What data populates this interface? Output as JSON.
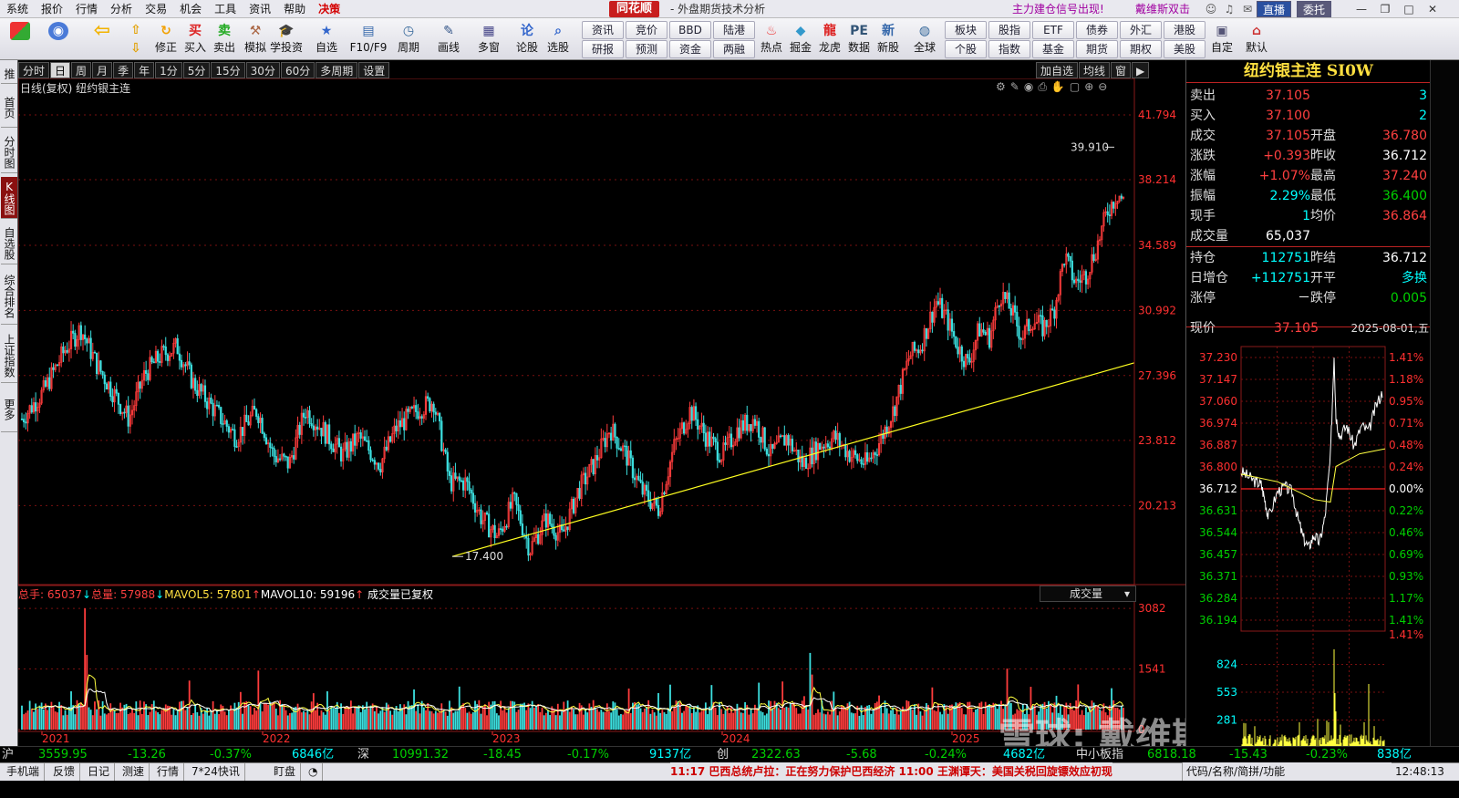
{
  "menu": [
    "系统",
    "报价",
    "行情",
    "分析",
    "交易",
    "机会",
    "工具",
    "资讯",
    "帮助",
    "决策"
  ],
  "brand": "同花顺",
  "brand_sub": "- 外盘期货技术分析",
  "menu_right": {
    "signal": "主力建仓信号出现!",
    "user": "戴维斯双击",
    "live": "直播",
    "entrust": "委托"
  },
  "toolbar": {
    "big": [
      {
        "label": "修正",
        "icon": "refresh-icon"
      },
      {
        "label": "买入",
        "icon": "buy-icon"
      },
      {
        "label": "卖出",
        "icon": "sell-icon"
      },
      {
        "label": "模拟",
        "icon": "hammer-icon"
      },
      {
        "label": "学投资",
        "icon": "graduation-icon"
      },
      {
        "label": "自选",
        "icon": "star-icon"
      },
      {
        "label": "F10/F9",
        "icon": "f10-icon"
      },
      {
        "label": "周期",
        "icon": "clock-icon"
      },
      {
        "label": "画线",
        "icon": "pen-icon"
      },
      {
        "label": "多窗",
        "icon": "windows-icon"
      },
      {
        "label": "论股",
        "icon": "chat-icon"
      },
      {
        "label": "选股",
        "icon": "search-icon"
      }
    ],
    "grid1": [
      "资讯",
      "竞价",
      "BBD",
      "陆港"
    ],
    "grid1b": [
      "研报",
      "预测",
      "资金",
      "两融"
    ],
    "big2": [
      {
        "label": "热点",
        "icon": "fire-icon"
      },
      {
        "label": "掘金",
        "icon": "gold-icon"
      },
      {
        "label": "龙虎",
        "icon": "dragon-icon"
      },
      {
        "label": "数据",
        "icon": "pe-icon"
      },
      {
        "label": "新股",
        "icon": "ipo-icon"
      },
      {
        "label": "全球",
        "icon": "globe-icon"
      }
    ],
    "grid2": [
      "板块",
      "股指",
      "ETF",
      "债券",
      "外汇",
      "港股"
    ],
    "grid2b": [
      "个股",
      "指数",
      "基金",
      "期货",
      "期权",
      "美股"
    ],
    "big3": [
      {
        "label": "自定",
        "icon": "custom-icon"
      },
      {
        "label": "默认",
        "icon": "home-icon"
      }
    ]
  },
  "left_tabs": [
    {
      "label": "推荐"
    },
    {
      "label": "首页"
    },
    {
      "label": "分时图"
    },
    {
      "label": "K线图",
      "active": true
    },
    {
      "label": "自选股"
    },
    {
      "label": "综合排名"
    },
    {
      "label": "上证指数"
    },
    {
      "label": "更多"
    }
  ],
  "period_tabs": [
    {
      "label": "分时"
    },
    {
      "label": "日",
      "active": true
    },
    {
      "label": "周"
    },
    {
      "label": "月"
    },
    {
      "label": "季"
    },
    {
      "label": "年"
    },
    {
      "label": "1分"
    },
    {
      "label": "5分"
    },
    {
      "label": "15分"
    },
    {
      "label": "30分"
    },
    {
      "label": "60分"
    },
    {
      "label": "多周期"
    },
    {
      "label": "设置"
    }
  ],
  "period_tabs_right": [
    "加自选",
    "均线",
    "窗",
    "▶"
  ],
  "chart": {
    "title": "日线(复权) 纽约银主连",
    "high_label": "39.910",
    "low_label": "17.400"
  },
  "vol_legend": {
    "a": "总手: 65037",
    "b": "总量: 57988",
    "c": "MAVOL5: 57801",
    "d": "MAVOL10: 59196",
    "e": "成交量已复权"
  },
  "vol_select": "成交量",
  "quote": {
    "name": "纽约银主连 SI0W",
    "rows": [
      {
        "l1": "卖出",
        "v1": "37.105",
        "c1": "red",
        "l2": "",
        "v2": "3",
        "c2": "cyan"
      },
      {
        "l1": "买入",
        "v1": "37.100",
        "c1": "red",
        "l2": "",
        "v2": "2",
        "c2": "cyan"
      },
      {
        "l1": "成交",
        "v1": "37.105",
        "c1": "red",
        "l2": "开盘",
        "v2": "36.780",
        "c2": "red"
      },
      {
        "l1": "涨跌",
        "v1": "+0.393",
        "c1": "red",
        "l2": "昨收",
        "v2": "36.712",
        "c2": "white"
      },
      {
        "l1": "涨幅",
        "v1": "+1.07%",
        "c1": "red",
        "l2": "最高",
        "v2": "37.240",
        "c2": "red"
      },
      {
        "l1": "振幅",
        "v1": "2.29%",
        "c1": "cyan",
        "l2": "最低",
        "v2": "36.400",
        "c2": "green"
      },
      {
        "l1": "现手",
        "v1": "1",
        "c1": "cyan",
        "l2": "均价",
        "v2": "36.864",
        "c2": "red"
      },
      {
        "l1": "成交量",
        "v1": "65,037",
        "c1": "white",
        "l2": "",
        "v2": "",
        "c2": "white"
      },
      {
        "l1": "持仓",
        "v1": "112751",
        "c1": "cyan",
        "l2": "昨结",
        "v2": "36.712",
        "c2": "white"
      },
      {
        "l1": "日增仓",
        "v1": "+112751",
        "c1": "cyan",
        "l2": "开平",
        "v2": "多换",
        "c2": "cyan"
      },
      {
        "l1": "涨停",
        "v1": "－",
        "c1": "white",
        "l2": "跌停",
        "v2": "0.005",
        "c2": "green"
      }
    ],
    "now_label": "现价",
    "now_value": "37.105",
    "date": "2025-08-01,五"
  },
  "chart_data": [
    {
      "type": "candlestick",
      "title": "日线(复权) 纽约银主连",
      "x": [
        "2021",
        "2022",
        "2023",
        "2024",
        "2025"
      ],
      "y_ticks": [
        41.794,
        38.214,
        34.589,
        30.992,
        27.396,
        23.812,
        20.213
      ],
      "ylim": [
        16.0,
        43.0
      ],
      "annotations": [
        {
          "label": "39.910",
          "value": 39.91
        },
        {
          "label": "17.400",
          "value": 17.4
        }
      ],
      "series": [
        {
          "values": [
            [
              0,
              25.0
            ],
            [
              0.02,
              26.5
            ],
            [
              0.04,
              28.8
            ],
            [
              0.055,
              30.0
            ],
            [
              0.07,
              28.0
            ],
            [
              0.085,
              26.5
            ],
            [
              0.1,
              25.0
            ],
            [
              0.115,
              27.5
            ],
            [
              0.13,
              28.5
            ],
            [
              0.145,
              29.0
            ],
            [
              0.16,
              27.0
            ],
            [
              0.18,
              25.5
            ],
            [
              0.2,
              24.0
            ],
            [
              0.22,
              25.5
            ],
            [
              0.235,
              23.0
            ],
            [
              0.25,
              22.5
            ],
            [
              0.265,
              25.5
            ],
            [
              0.28,
              24.5
            ],
            [
              0.3,
              23.0
            ],
            [
              0.315,
              24.0
            ],
            [
              0.335,
              22.5
            ],
            [
              0.35,
              24.5
            ],
            [
              0.37,
              25.5
            ],
            [
              0.385,
              26.0
            ],
            [
              0.4,
              21.5
            ],
            [
              0.415,
              21.5
            ],
            [
              0.43,
              19.5
            ],
            [
              0.445,
              18.5
            ],
            [
              0.46,
              20.5
            ],
            [
              0.475,
              17.8
            ],
            [
              0.49,
              19.5
            ],
            [
              0.505,
              18.5
            ],
            [
              0.52,
              21.0
            ],
            [
              0.535,
              22.5
            ],
            [
              0.55,
              24.5
            ],
            [
              0.565,
              23.0
            ],
            [
              0.58,
              21.0
            ],
            [
              0.595,
              20.0
            ],
            [
              0.61,
              23.5
            ],
            [
              0.625,
              25.5
            ],
            [
              0.64,
              24.0
            ],
            [
              0.655,
              23.0
            ],
            [
              0.67,
              24.5
            ],
            [
              0.685,
              25.0
            ],
            [
              0.7,
              23.0
            ],
            [
              0.715,
              24.0
            ],
            [
              0.73,
              22.5
            ],
            [
              0.745,
              23.5
            ],
            [
              0.76,
              24.0
            ],
            [
              0.775,
              23.0
            ],
            [
              0.79,
              22.5
            ],
            [
              0.8,
              23.5
            ],
            [
              0.815,
              25.5
            ],
            [
              0.83,
              28.5
            ],
            [
              0.84,
              29.0
            ],
            [
              0.855,
              31.5
            ],
            [
              0.865,
              30.5
            ],
            [
              0.875,
              29.0
            ],
            [
              0.885,
              28.0
            ],
            [
              0.895,
              30.0
            ],
            [
              0.905,
              29.5
            ],
            [
              0.915,
              32.0
            ],
            [
              0.925,
              31.0
            ],
            [
              0.935,
              29.5
            ],
            [
              0.945,
              30.5
            ],
            [
              0.955,
              30.0
            ],
            [
              0.965,
              31.0
            ],
            [
              0.975,
              34.0
            ],
            [
              0.985,
              32.5
            ],
            [
              0.995,
              33.0
            ],
            [
              1.005,
              34.5
            ],
            [
              1.015,
              36.5
            ],
            [
              1.025,
              37.5
            ],
            [
              1.035,
              36.5
            ]
          ]
        }
      ]
    },
    {
      "type": "bar",
      "title": "成交量",
      "y_ticks": [
        3082,
        1541,
        0
      ],
      "ylim": [
        0,
        3200
      ],
      "series": [
        {
          "name": "总量",
          "values": [
            500,
            900,
            2800,
            700,
            600,
            500,
            800,
            600,
            1200,
            700
          ]
        }
      ]
    },
    {
      "type": "line",
      "title": "分时",
      "y_ticks_left": [
        37.23,
        37.147,
        37.06,
        36.974,
        36.887,
        36.8,
        36.712,
        36.631,
        36.544,
        36.457,
        36.371,
        36.284,
        36.194
      ],
      "y_ticks_right": [
        "1.41%",
        "1.18%",
        "0.95%",
        "0.71%",
        "0.48%",
        "0.24%",
        "0.00%",
        "0.22%",
        "0.46%",
        "0.69%",
        "0.93%",
        "1.17%",
        "1.41%"
      ],
      "vol_ticks": [
        824,
        553,
        281
      ]
    }
  ],
  "axes": {
    "price": [
      "41.794",
      "38.214",
      "34.589",
      "30.992",
      "27.396",
      "23.812",
      "20.213"
    ],
    "vol": [
      "3082",
      "1541",
      "0"
    ],
    "years": [
      "2021",
      "2022",
      "2023",
      "2024",
      "2025"
    ],
    "intraday_left": [
      "37.230",
      "37.147",
      "37.060",
      "36.974",
      "36.887",
      "36.800",
      "36.712",
      "36.631",
      "36.544",
      "36.457",
      "36.371",
      "36.284",
      "36.194"
    ],
    "intraday_right": [
      "1.41%",
      "1.18%",
      "0.95%",
      "0.71%",
      "0.48%",
      "0.24%",
      "0.00%",
      "0.22%",
      "0.46%",
      "0.69%",
      "0.93%",
      "1.17%",
      "1.41%"
    ],
    "intraday_vol": [
      "824",
      "553",
      "281"
    ]
  },
  "index_bar": {
    "sh": {
      "name": "沪",
      "v": "3559.95",
      "c": "-13.26",
      "p": "-0.37%",
      "a": "6846亿"
    },
    "sz": {
      "name": "深",
      "v": "10991.32",
      "c": "-18.45",
      "p": "-0.17%",
      "a": "9137亿"
    },
    "cy": {
      "name": "创",
      "v": "2322.63",
      "c": "-5.68",
      "p": "-0.24%",
      "a": "4682亿"
    },
    "zx": {
      "name": "中小板指",
      "v": "6818.18",
      "c": "-15.43",
      "p": "-0.23%",
      "a": "838亿"
    }
  },
  "status": [
    "手机端",
    "反馈",
    "日记",
    "测速",
    "行情",
    "7*24快讯",
    "盯盘"
  ],
  "ticker": "11:17 巴西总统卢拉：正在努力保护巴西经济    11:00 王渊谭天：美国关税回旋镖效应初现",
  "ticker_right": "代码/名称/简拼/功能",
  "clock": "12:48:13",
  "watermark": "雪球: 戴维斯双击"
}
